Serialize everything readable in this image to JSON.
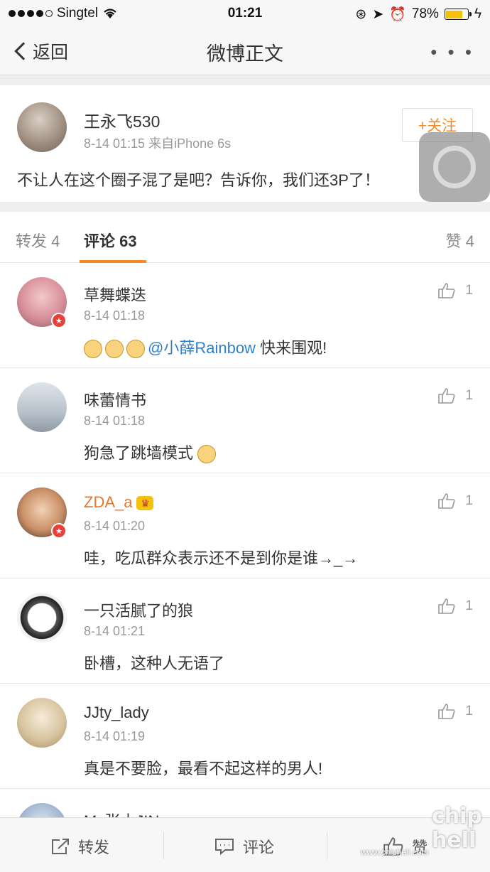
{
  "status_bar": {
    "carrier": "Singtel",
    "time": "01:21",
    "battery": "78%",
    "battery_level": 0.78
  },
  "nav": {
    "back_label": "返回",
    "title": "微博正文",
    "more_label": "• • •"
  },
  "post": {
    "author": "王永飞530",
    "meta": "8-14 01:15  来自iPhone 6s",
    "follow_label": "+关注",
    "text": "不让人在这个圈子混了是吧？告诉你，我们还3P了！"
  },
  "tabs": {
    "forward": "转发 4",
    "comment": "评论 63",
    "like": "赞 4"
  },
  "comments": [
    {
      "name": "草舞蝶迭",
      "time": "8-14 01:18",
      "text_pre": "",
      "mention": "@小薛Rainbow",
      "text": " 快来围观!",
      "likes": "1"
    },
    {
      "name": "味蕾情书",
      "time": "8-14 01:18",
      "text": "狗急了跳墙模式",
      "likes": "1"
    },
    {
      "name": "ZDA_a",
      "time": "8-14 01:20",
      "text": "哇，吃瓜群众表示还不是到你是谁→_→",
      "likes": "1"
    },
    {
      "name": "一只活腻了的狼",
      "time": "8-14 01:21",
      "text": "卧槽，这种人无语了",
      "likes": "1"
    },
    {
      "name": "JJty_lady",
      "time": "8-14 01:19",
      "text": "真是不要脸，最看不起这样的男人!",
      "likes": "1"
    },
    {
      "name": "Ms张小JIN",
      "time": "",
      "text": "",
      "likes": ""
    }
  ],
  "bottom_bar": {
    "forward": "转发",
    "comment": "评论",
    "like": "赞"
  },
  "watermark": {
    "logo": "chip hell",
    "url": "www.chiphell.com"
  },
  "colors": {
    "accent_orange": "#f28c28",
    "mention_blue": "#2f7fd1",
    "vip_orange": "#e8762b"
  }
}
